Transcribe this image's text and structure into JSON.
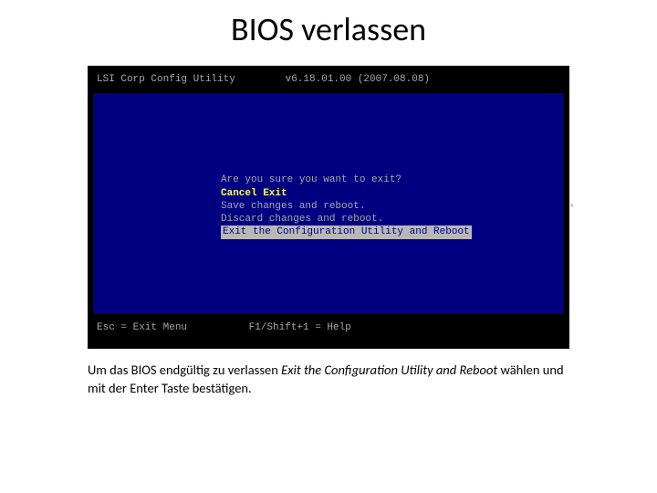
{
  "title": "BIOS verlassen",
  "bios": {
    "header_name": "LSI Corp Config Utility",
    "header_ver": "v6.18.01.00 (2007.08.08)",
    "prompt": "Are you sure you want to exit?",
    "opt_cancel": "Cancel Exit",
    "opt_save": "Save changes and reboot.",
    "opt_discard": "Discard changes and reboot.",
    "opt_exit": "Exit the Configuration Utility and Reboot",
    "footer_esc": "Esc = Exit Menu",
    "footer_help": "F1/Shift+1 = Help"
  },
  "caption": {
    "pre": "Um das BIOS endgültig zu verlassen ",
    "italic": "Exit the Configuration Utility and Reboot",
    "post": " wählen und mit der Enter Taste bestätigen."
  }
}
